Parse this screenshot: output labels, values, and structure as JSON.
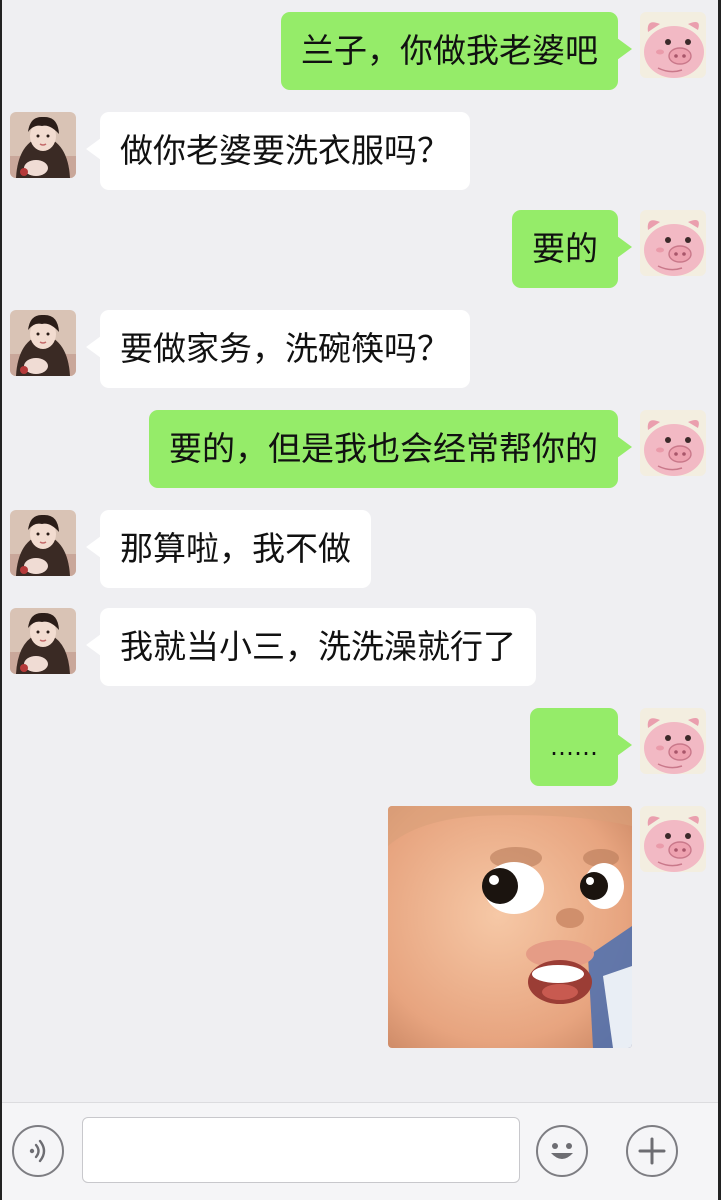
{
  "messages": [
    {
      "side": "me",
      "text": "兰子，你做我老婆吧"
    },
    {
      "side": "other",
      "text": "做你老婆要洗衣服吗？"
    },
    {
      "side": "me",
      "text": "要的"
    },
    {
      "side": "other",
      "text": "要做家务，洗碗筷吗？"
    },
    {
      "side": "me",
      "text": "要的，但是我也会经常帮你的"
    },
    {
      "side": "other",
      "text": "那算啦，我不做"
    },
    {
      "side": "other",
      "text": "我就当小三，洗洗澡就行了"
    },
    {
      "side": "me",
      "text": "……"
    },
    {
      "side": "me",
      "type": "sticker",
      "sticker": "surprised-baby-face-sticker"
    }
  ],
  "avatars": {
    "me": "pink-pig-avatar",
    "other": "woman-photo-avatar"
  },
  "input_bar": {
    "voice_icon": "voice-icon",
    "input_value": "",
    "emoji_icon": "emoji-icon",
    "plus_icon": "plus-icon"
  },
  "colors": {
    "my_bubble": "#95ec69",
    "their_bubble": "#ffffff",
    "chat_background": "#efeff2"
  }
}
